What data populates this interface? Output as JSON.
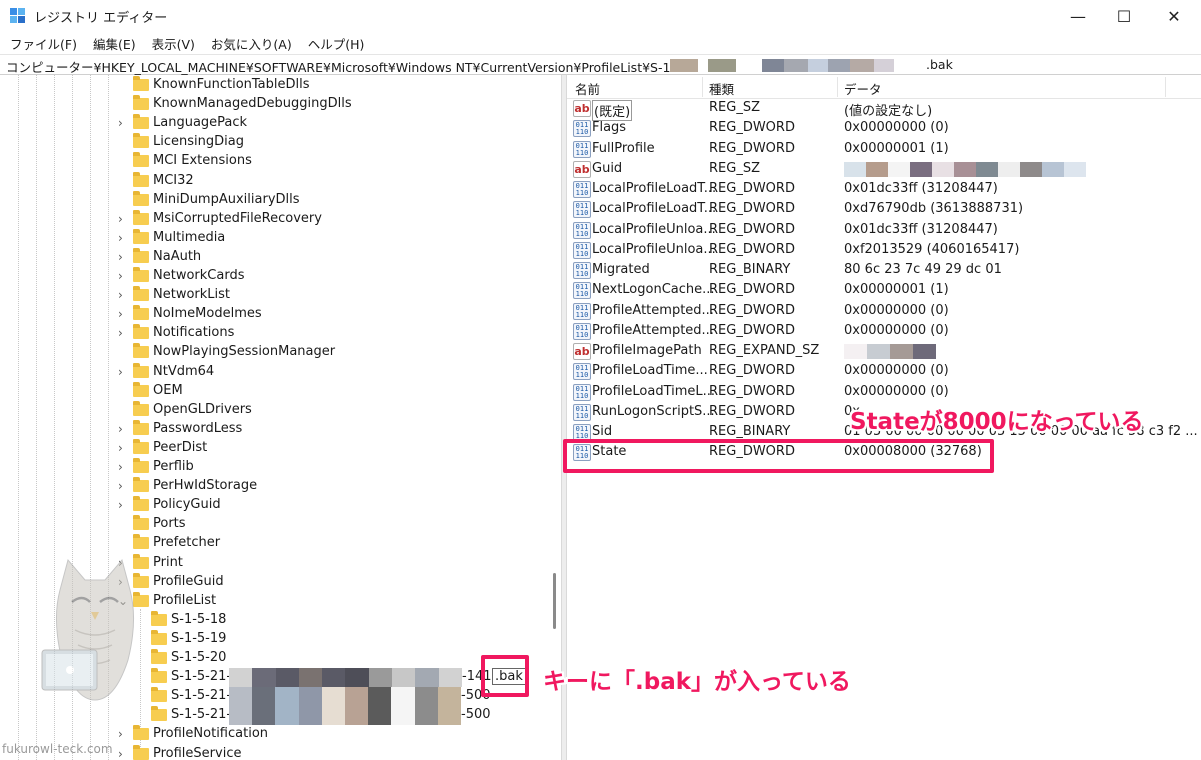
{
  "window": {
    "title": "レジストリ エディター",
    "minimize": "—",
    "maximize": "☐",
    "close": "✕"
  },
  "menu": [
    "ファイル(F)",
    "編集(E)",
    "表示(V)",
    "お気に入り(A)",
    "ヘルプ(H)"
  ],
  "address": {
    "path": "コンピューター¥HKEY_LOCAL_MACHINE¥SOFTWARE¥Microsoft¥Windows NT¥CurrentVersion¥ProfileList¥S-1-5-21-",
    "suffix": ".bak"
  },
  "tree": {
    "items": [
      {
        "label": "KnownFunctionTableDlls",
        "expandable": false
      },
      {
        "label": "KnownManagedDebuggingDlls",
        "expandable": false
      },
      {
        "label": "LanguagePack",
        "expandable": true
      },
      {
        "label": "LicensingDiag",
        "expandable": false
      },
      {
        "label": "MCI Extensions",
        "expandable": false
      },
      {
        "label": "MCI32",
        "expandable": false
      },
      {
        "label": "MiniDumpAuxiliaryDlls",
        "expandable": false
      },
      {
        "label": "MsiCorruptedFileRecovery",
        "expandable": true
      },
      {
        "label": "Multimedia",
        "expandable": true
      },
      {
        "label": "NaAuth",
        "expandable": true
      },
      {
        "label": "NetworkCards",
        "expandable": true
      },
      {
        "label": "NetworkList",
        "expandable": true
      },
      {
        "label": "NoImeModelmes",
        "expandable": true
      },
      {
        "label": "Notifications",
        "expandable": true
      },
      {
        "label": "NowPlayingSessionManager",
        "expandable": false
      },
      {
        "label": "NtVdm64",
        "expandable": true
      },
      {
        "label": "OEM",
        "expandable": false
      },
      {
        "label": "OpenGLDrivers",
        "expandable": false
      },
      {
        "label": "PasswordLess",
        "expandable": true
      },
      {
        "label": "PeerDist",
        "expandable": true
      },
      {
        "label": "Perflib",
        "expandable": true
      },
      {
        "label": "PerHwIdStorage",
        "expandable": true
      },
      {
        "label": "PolicyGuid",
        "expandable": true
      },
      {
        "label": "Ports",
        "expandable": false
      },
      {
        "label": "Prefetcher",
        "expandable": false
      },
      {
        "label": "Print",
        "expandable": true
      },
      {
        "label": "ProfileGuid",
        "expandable": true
      },
      {
        "label": "ProfileList",
        "expandable": true,
        "expanded": true
      }
    ],
    "subitems": [
      {
        "label": "S-1-5-18"
      },
      {
        "label": "S-1-5-19"
      },
      {
        "label": "S-1-5-20"
      },
      {
        "label": "S-1-5-21-",
        "tail": "-141",
        "bak": ".bak",
        "selected": true
      },
      {
        "label": "S-1-5-21-",
        "tail": "-500"
      },
      {
        "label": "S-1-5-21-",
        "tail": "-500"
      }
    ],
    "after": [
      {
        "label": "ProfileNotification",
        "expandable": true
      },
      {
        "label": "ProfileService",
        "expandable": true
      }
    ]
  },
  "list": {
    "headers": {
      "name": "名前",
      "type": "種類",
      "data": "データ"
    },
    "rows": [
      {
        "icon": "string",
        "name": "(既定)",
        "type": "REG_SZ",
        "data": "(値の設定なし)"
      },
      {
        "icon": "binary",
        "name": "Flags",
        "type": "REG_DWORD",
        "data": "0x00000000 (0)"
      },
      {
        "icon": "binary",
        "name": "FullProfile",
        "type": "REG_DWORD",
        "data": "0x00000001 (1)"
      },
      {
        "icon": "string",
        "name": "Guid",
        "type": "REG_SZ",
        "data": ""
      },
      {
        "icon": "binary",
        "name": "LocalProfileLoadT...",
        "type": "REG_DWORD",
        "data": "0x01dc33ff (31208447)"
      },
      {
        "icon": "binary",
        "name": "LocalProfileLoadT...",
        "type": "REG_DWORD",
        "data": "0xd76790db (3613888731)"
      },
      {
        "icon": "binary",
        "name": "LocalProfileUnloa...",
        "type": "REG_DWORD",
        "data": "0x01dc33ff (31208447)"
      },
      {
        "icon": "binary",
        "name": "LocalProfileUnloa...",
        "type": "REG_DWORD",
        "data": "0xf2013529 (4060165417)"
      },
      {
        "icon": "binary",
        "name": "Migrated",
        "type": "REG_BINARY",
        "data": "80 6c 23 7c 49 29 dc 01"
      },
      {
        "icon": "binary",
        "name": "NextLogonCache...",
        "type": "REG_DWORD",
        "data": "0x00000001 (1)"
      },
      {
        "icon": "binary",
        "name": "ProfileAttempted...",
        "type": "REG_DWORD",
        "data": "0x00000000 (0)"
      },
      {
        "icon": "binary",
        "name": "ProfileAttempted...",
        "type": "REG_DWORD",
        "data": "0x00000000 (0)"
      },
      {
        "icon": "string",
        "name": "ProfileImagePath",
        "type": "REG_EXPAND_SZ",
        "data": ""
      },
      {
        "icon": "binary",
        "name": "ProfileLoadTime...",
        "type": "REG_DWORD",
        "data": "0x00000000 (0)"
      },
      {
        "icon": "binary",
        "name": "ProfileLoadTimeL...",
        "type": "REG_DWORD",
        "data": "0x00000000 (0)"
      },
      {
        "icon": "binary",
        "name": "RunLogonScriptS...",
        "type": "REG_DWORD",
        "data": "0x"
      },
      {
        "icon": "binary",
        "name": "Sid",
        "type": "REG_BINARY",
        "data": "01 05 00 00 00 00 00 05 15 00 00 00 aa fc 58 c3 f2 ..."
      },
      {
        "icon": "binary",
        "name": "State",
        "type": "REG_DWORD",
        "data": "0x00008000 (32768)"
      }
    ]
  },
  "annotations": {
    "state": "Stateが8000になっている",
    "key": "キーに「.bak」が入っている",
    "accent_color": "#f0185f"
  },
  "watermark": "fukurowl-teck.com",
  "icons": {
    "string_glyph": "ab",
    "binary_glyph": "011 110"
  }
}
